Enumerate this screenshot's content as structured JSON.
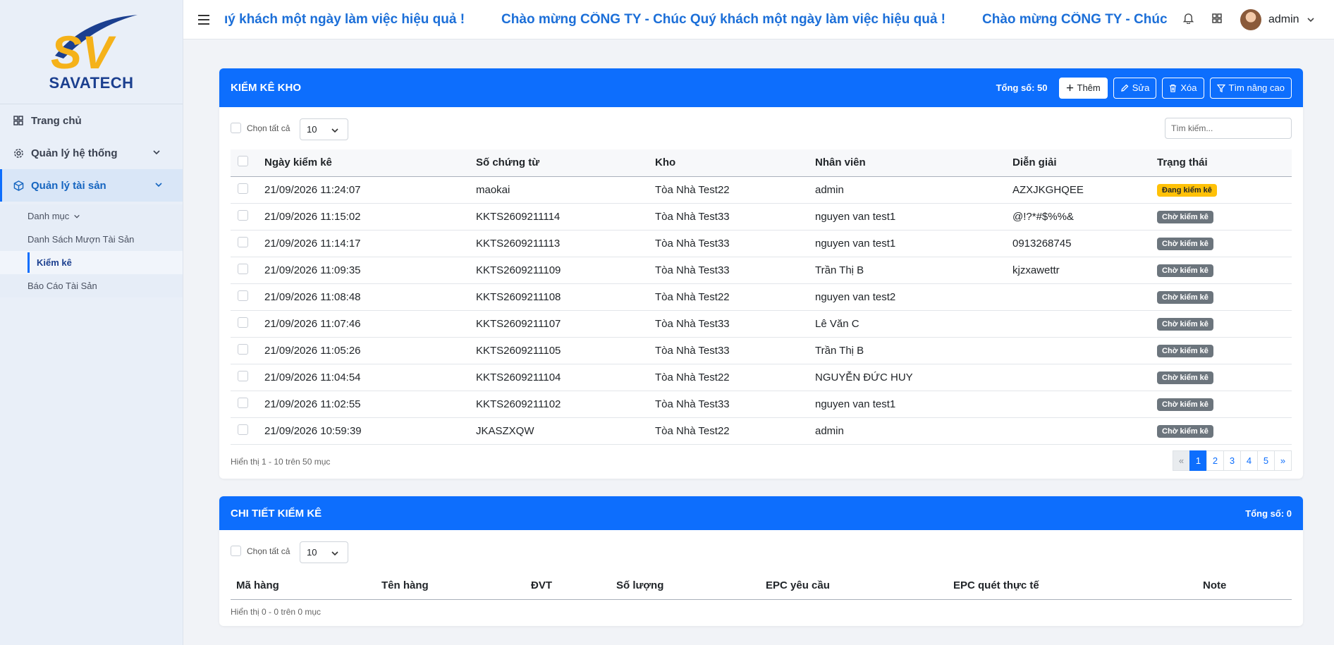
{
  "brand": {
    "name": "SAVATECH",
    "mark": "SV"
  },
  "sidebar": {
    "items": [
      {
        "label": "Trang chủ",
        "icon": "dashboard-icon"
      },
      {
        "label": "Quản lý hệ thống",
        "icon": "gear-icon"
      },
      {
        "label": "Quản lý tài sản",
        "icon": "box-icon"
      }
    ],
    "sub_items": [
      {
        "label": "Danh mục"
      },
      {
        "label": "Danh Sách Mượn Tài Sản"
      },
      {
        "label": "Kiểm kê"
      },
      {
        "label": "Báo Cáo Tài Sản"
      }
    ]
  },
  "topbar": {
    "marquee_segments": [
      "ıý khách một ngày làm việc hiệu quả !",
      "Chào mừng CÔNG TY - Chúc Quý khách một ngày làm việc hiệu quả !",
      "Chào mừng CÔNG TY - Chúc Quý k"
    ],
    "user": "admin"
  },
  "inventory": {
    "title": "KIỂM KÊ KHO",
    "total": "Tổng số: 50",
    "buttons": {
      "add": "Thêm",
      "edit": "Sửa",
      "delete": "Xóa",
      "advanced": "Tìm nâng cao"
    },
    "select_all": "Chọn tất cả",
    "page_size": "10",
    "search_placeholder": "Tìm kiếm...",
    "columns": [
      "Ngày kiểm kê",
      "Số chứng từ",
      "Kho",
      "Nhân viên",
      "Diễn giải",
      "Trạng thái"
    ],
    "rows": [
      {
        "date": "21/09/2026 11:24:07",
        "doc": "maokai",
        "store": "Tòa Nhà Test22",
        "staff": "admin",
        "desc": "AZXJKGHQEE",
        "status": "Đang kiểm kê",
        "status_type": "warn"
      },
      {
        "date": "21/09/2026 11:15:02",
        "doc": "KKTS2609211114",
        "store": "Tòa Nhà Test33",
        "staff": "nguyen van test1",
        "desc": "@!?*#$%%&",
        "status": "Chờ kiểm kê",
        "status_type": "pending"
      },
      {
        "date": "21/09/2026 11:14:17",
        "doc": "KKTS2609211113",
        "store": "Tòa Nhà Test33",
        "staff": "nguyen van test1",
        "desc": "0913268745",
        "status": "Chờ kiểm kê",
        "status_type": "pending"
      },
      {
        "date": "21/09/2026 11:09:35",
        "doc": "KKTS2609211109",
        "store": "Tòa Nhà Test33",
        "staff": "Trần Thị B",
        "desc": "kjzxawettr",
        "status": "Chờ kiểm kê",
        "status_type": "pending"
      },
      {
        "date": "21/09/2026 11:08:48",
        "doc": "KKTS2609211108",
        "store": "Tòa Nhà Test22",
        "staff": "nguyen van test2",
        "desc": "",
        "status": "Chờ kiểm kê",
        "status_type": "pending"
      },
      {
        "date": "21/09/2026 11:07:46",
        "doc": "KKTS2609211107",
        "store": "Tòa Nhà Test33",
        "staff": "Lê Văn C",
        "desc": "",
        "status": "Chờ kiểm kê",
        "status_type": "pending"
      },
      {
        "date": "21/09/2026 11:05:26",
        "doc": "KKTS2609211105",
        "store": "Tòa Nhà Test33",
        "staff": "Trần Thị B",
        "desc": "",
        "status": "Chờ kiểm kê",
        "status_type": "pending"
      },
      {
        "date": "21/09/2026 11:04:54",
        "doc": "KKTS2609211104",
        "store": "Tòa Nhà Test22",
        "staff": "NGUYỄN ĐỨC HUY",
        "desc": "",
        "status": "Chờ kiểm kê",
        "status_type": "pending"
      },
      {
        "date": "21/09/2026 11:02:55",
        "doc": "KKTS2609211102",
        "store": "Tòa Nhà Test33",
        "staff": "nguyen van test1",
        "desc": "",
        "status": "Chờ kiểm kê",
        "status_type": "pending"
      },
      {
        "date": "21/09/2026 10:59:39",
        "doc": "JKASZXQW",
        "store": "Tòa Nhà Test22",
        "staff": "admin",
        "desc": "",
        "status": "Chờ kiểm kê",
        "status_type": "pending"
      }
    ],
    "info": "Hiển thị 1 - 10 trên 50 mục",
    "pagination": {
      "prev": "«",
      "pages": [
        "1",
        "2",
        "3",
        "4",
        "5"
      ],
      "next": "»",
      "current": "1"
    }
  },
  "detail": {
    "title": "CHI TIẾT KIỂM KÊ",
    "total": "Tổng số: 0",
    "select_all": "Chọn tất cả",
    "page_size": "10",
    "columns": [
      "Mã hàng",
      "Tên hàng",
      "ĐVT",
      "Số lượng",
      "EPC yêu cầu",
      "EPC quét thực tế",
      "Note"
    ],
    "info": "Hiển thị 0 - 0 trên 0 mục"
  },
  "colors": {
    "primary": "#0d6efd",
    "warn": "#ffc107",
    "pending": "#6c757d",
    "marquee": "#1c6fd8"
  }
}
